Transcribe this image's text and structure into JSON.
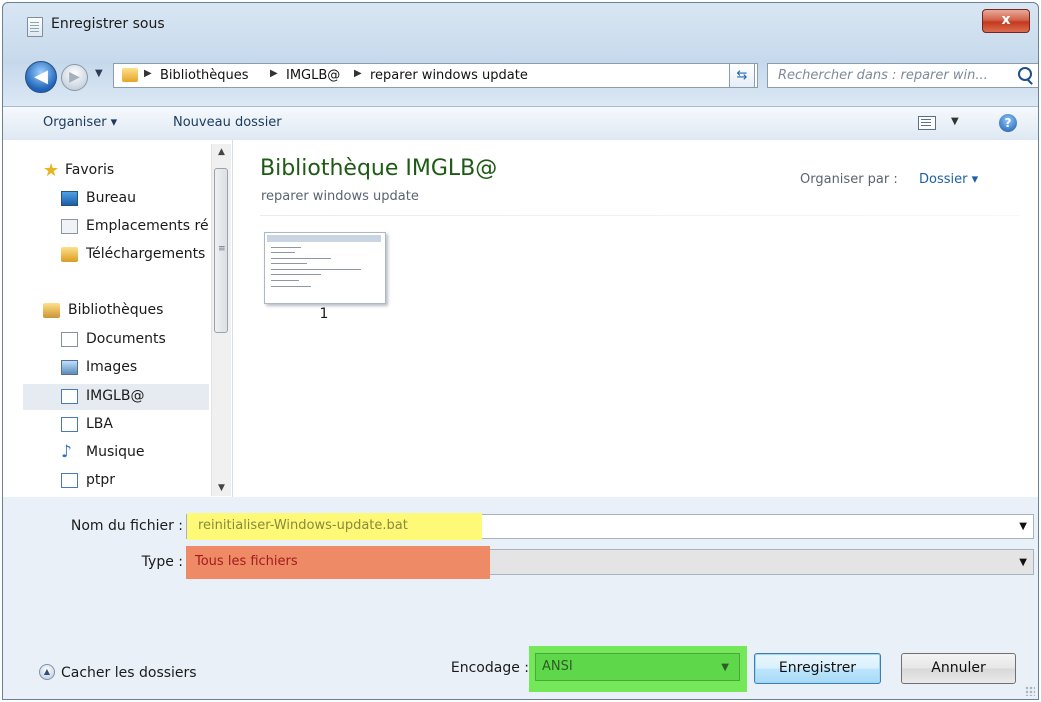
{
  "window": {
    "title": "Enregistrer sous",
    "close_label": "x"
  },
  "address_bar": {
    "crumbs": [
      "Bibliothèques",
      "IMGLB@",
      "reparer windows update"
    ],
    "search_placeholder": "Rechercher dans : reparer win..."
  },
  "toolbar": {
    "organize_label": "Organiser ▾",
    "new_folder_label": "Nouveau dossier",
    "help_label": "?"
  },
  "nav_pane": {
    "favorites_header": "Favoris",
    "favorites": [
      "Bureau",
      "Emplacements récents",
      "Téléchargements"
    ],
    "libraries_header": "Bibliothèques",
    "libraries": [
      "Documents",
      "Images",
      "IMGLB@",
      "LBA",
      "Musique",
      "ptpr"
    ],
    "selected": "IMGLB@"
  },
  "content": {
    "library_title": "Bibliothèque IMGLB@",
    "library_subtitle": "reparer windows update",
    "arrange_label": "Organiser par :",
    "arrange_value": "Dossier ▾",
    "files": [
      {
        "name": "1"
      }
    ]
  },
  "form": {
    "filename_label": "Nom du fichier :",
    "filename_value": "reinitialiser-Windows-update.bat",
    "type_label": "Type :",
    "type_value": "Tous les fichiers",
    "encoding_label": "Encodage :",
    "encoding_value": "ANSI",
    "hide_folders_label": "Cacher les dossiers",
    "save_button": "Enregistrer",
    "cancel_button": "Annuler"
  },
  "highlight_colors": {
    "filename": "#fff978",
    "type": "#ef8a66",
    "encoding": "#75e85a"
  }
}
